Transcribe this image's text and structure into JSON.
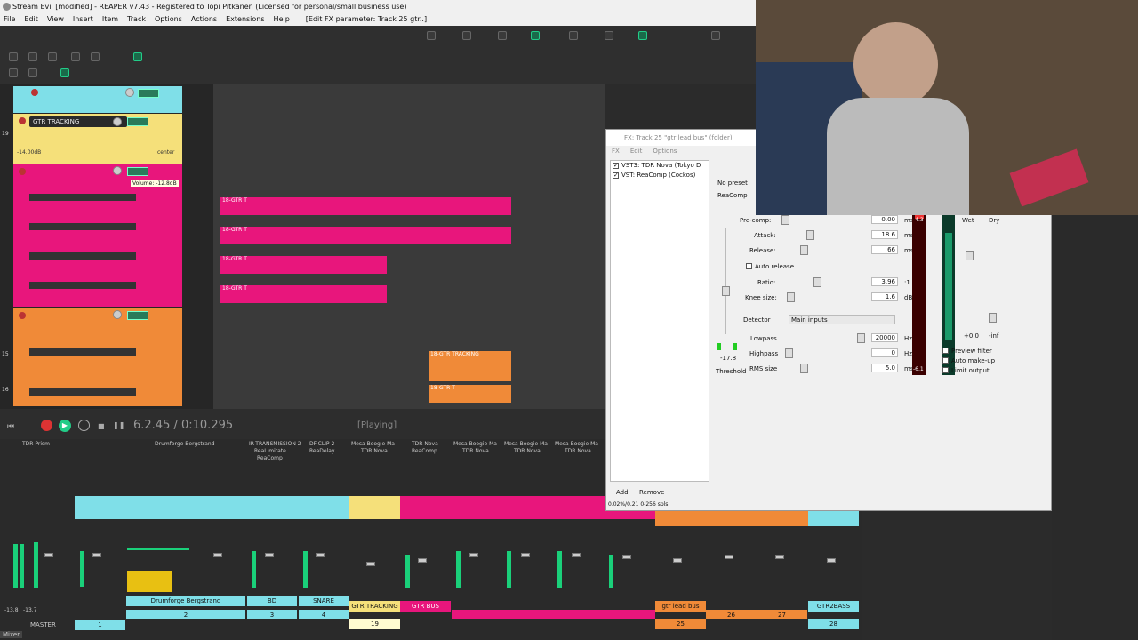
{
  "window": {
    "title": "Stream Evil [modified] - REAPER v7.43 - Registered to Topi Pitkänen (Licensed for personal/small business use)"
  },
  "menu": {
    "items": [
      "File",
      "Edit",
      "View",
      "Insert",
      "Item",
      "Track",
      "Options",
      "Actions",
      "Extensions",
      "Help"
    ],
    "context": "[Edit FX parameter: Track 25 gtr..]"
  },
  "tracks": {
    "gtr_tracking_name": "GTR TRACKING",
    "gtr_tracking_vol": "-14.00dB",
    "gtr_tracking_pan": "center",
    "tooltip": "Volume: -12.8dB",
    "numbers": [
      "19",
      "15",
      "16"
    ]
  },
  "transport": {
    "time": "6.2.45 / 0:10.295",
    "status": "[Playing]"
  },
  "mixer": {
    "fx_slots": [
      "TDR Prism",
      "Drumforge Bergstrand",
      "IR-TRANSMISSION 2",
      "ReaLimitate",
      "ReaComp",
      "DF:CLIP 2",
      "ReaDelay",
      "Mesa Boogie Ma",
      "TDR Nova",
      "TDR Nova",
      "ReaComp",
      "Mesa Boogie Ma",
      "TDR Nova",
      "Mesa Boogie Ma",
      "TDR Nova",
      "Mesa Boogie Ma",
      "TDR Nova"
    ],
    "channel_names": [
      "Drumforge Bergstrand",
      "BD",
      "SNARE",
      "GTR TRACKING",
      "GTR BUS",
      "gtr lead bus",
      "GTR2BASS"
    ],
    "channel_numbers": [
      "1",
      "2",
      "3",
      "4",
      "19",
      "25",
      "26",
      "27",
      "28"
    ],
    "master_label": "MASTER",
    "master_levels": [
      "-13.8",
      "-13.7"
    ],
    "mixer_tab": "Mixer"
  },
  "fx": {
    "title": "FX: Track 25 \"gtr lead bus\" (folder)",
    "menu": [
      "FX",
      "Edit",
      "Options"
    ],
    "list": [
      {
        "checked": true,
        "name": "VST3: TDR Nova (Tokyo D"
      },
      {
        "checked": true,
        "name": "VST: ReaComp (Cockos)"
      }
    ],
    "preset": "No preset",
    "plugin_name": "ReaComp",
    "params": [
      {
        "label": "Pre-comp:",
        "value": "0.00",
        "unit": "ms"
      },
      {
        "label": "Attack:",
        "value": "18.6",
        "unit": "ms"
      },
      {
        "label": "Release:",
        "value": "66",
        "unit": "ms"
      },
      {
        "label": "Ratio:",
        "value": "3.96",
        "unit": ":1"
      },
      {
        "label": "Knee size:",
        "value": "1.6",
        "unit": "dB"
      },
      {
        "label": "Lowpass",
        "value": "20000",
        "unit": "Hz"
      },
      {
        "label": "Highpass",
        "value": "0",
        "unit": "Hz"
      },
      {
        "label": "RMS size",
        "value": "5.0",
        "unit": "ms"
      }
    ],
    "auto_release": "Auto release",
    "detector_label": "Detector",
    "detector_value": "Main inputs",
    "threshold_value": "-17.8",
    "threshold_label": "Threshold",
    "wet_label": "Wet",
    "dry_label": "Dry",
    "wet_value": "+0.0",
    "dry_value": "-inf",
    "options": [
      "Preview filter",
      "Auto make-up",
      "Limit output"
    ],
    "meter_top": "-4.3",
    "meter_bottom": "-6.1",
    "add_label": "Add",
    "remove_label": "Remove",
    "cpu": "0.02%/0.21 0-256 spls"
  },
  "colors": {
    "cyan": "#7fdfe8",
    "pink": "#e8167c",
    "orange": "#f08a38",
    "yellow": "#f5e07a",
    "green_meter": "#1ad07a"
  }
}
